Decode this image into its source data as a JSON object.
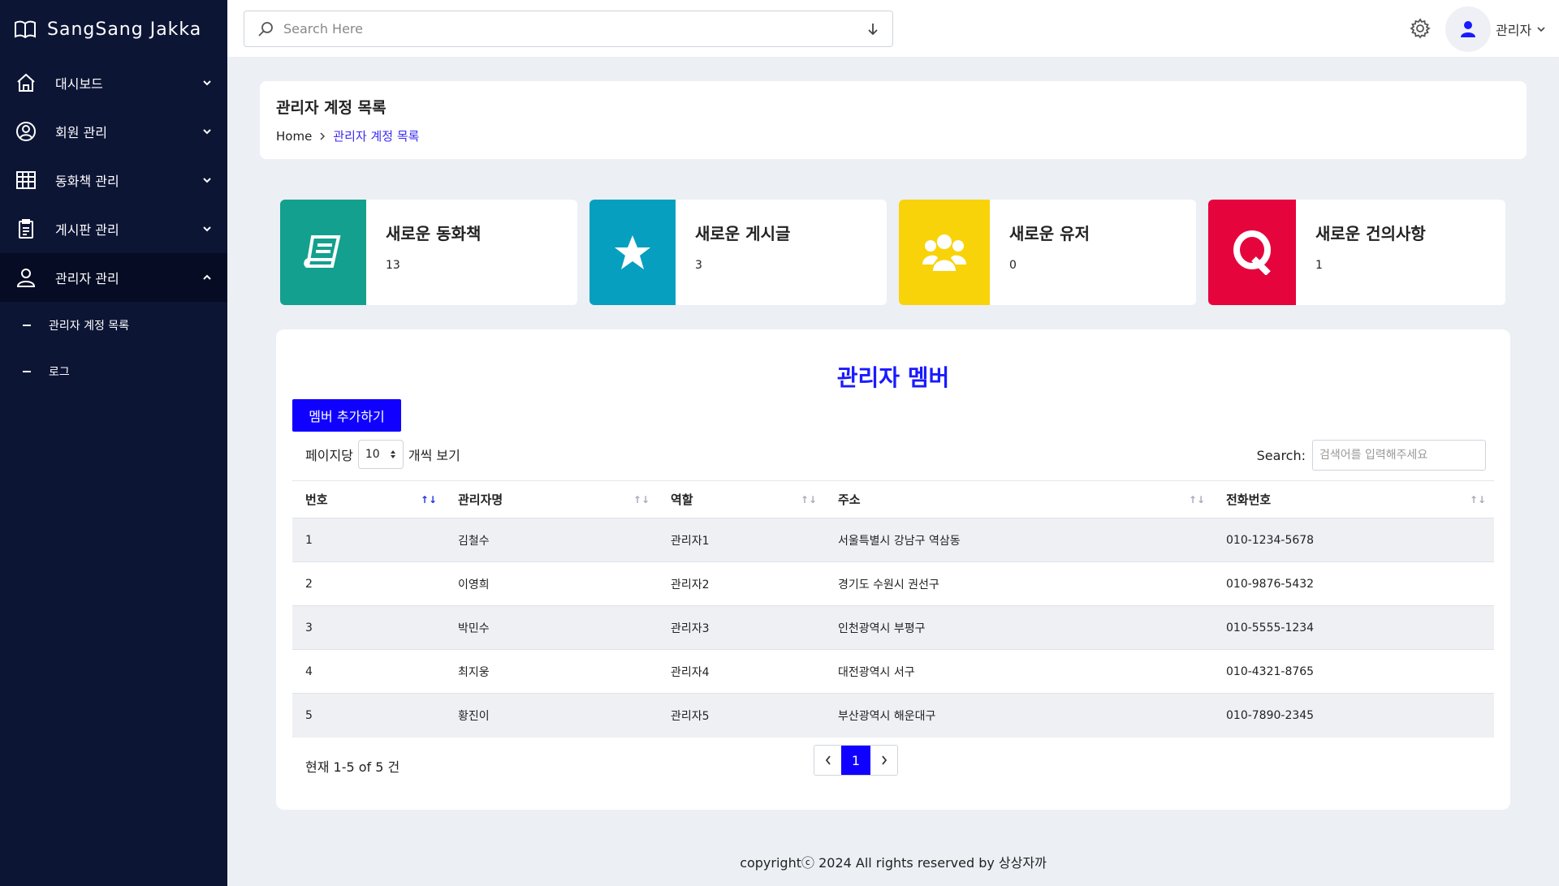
{
  "brand": {
    "name": "SangSang Jakka"
  },
  "sidebar": {
    "items": [
      {
        "label": "대시보드",
        "icon": "home-icon"
      },
      {
        "label": "회원 관리",
        "icon": "user-circle-icon"
      },
      {
        "label": "동화책 관리",
        "icon": "grid-icon"
      },
      {
        "label": "게시판 관리",
        "icon": "clipboard-icon"
      },
      {
        "label": "관리자 관리",
        "icon": "user-icon"
      }
    ],
    "sub_items": [
      {
        "label": "관리자 계정 목록"
      },
      {
        "label": "로그"
      }
    ]
  },
  "topbar": {
    "search_placeholder": "Search Here",
    "user_name": "관리자"
  },
  "header": {
    "title": "관리자 계정 목록",
    "breadcrumb_home": "Home",
    "breadcrumb_current": "관리자 계정 목록"
  },
  "stats": [
    {
      "title": "새로운 동화책",
      "value": "13",
      "color": "#14a08e",
      "icon": "book-icon"
    },
    {
      "title": "새로운 게시글",
      "value": "3",
      "color": "#079fbf",
      "icon": "star-icon"
    },
    {
      "title": "새로운 유저",
      "value": "0",
      "color": "#f8d30a",
      "icon": "users-icon"
    },
    {
      "title": "새로운 건의사항",
      "value": "1",
      "color": "#e6043c",
      "icon": "q-icon"
    }
  ],
  "members": {
    "heading": "관리자 멤버",
    "add_button": "멤버 추가하기",
    "per_page_prefix": "페이지당",
    "per_page_value": "10",
    "per_page_suffix": "개씩 보기",
    "search_label": "Search:",
    "search_placeholder": "검색어를 입력해주세요",
    "columns": [
      "번호",
      "관리자명",
      "역할",
      "주소",
      "전화번호"
    ],
    "rows": [
      [
        "1",
        "김철수",
        "관리자1",
        "서울특별시 강남구 역삼동",
        "010-1234-5678"
      ],
      [
        "2",
        "이영희",
        "관리자2",
        "경기도 수원시 권선구",
        "010-9876-5432"
      ],
      [
        "3",
        "박민수",
        "관리자3",
        "인천광역시 부평구",
        "010-5555-1234"
      ],
      [
        "4",
        "최지웅",
        "관리자4",
        "대전광역시 서구",
        "010-4321-8765"
      ],
      [
        "5",
        "황진이",
        "관리자5",
        "부산광역시 해운대구",
        "010-7890-2345"
      ]
    ],
    "result_info": "현재 1-5 of 5 건",
    "current_page": "1"
  },
  "footer": {
    "text": "copyrightⓒ 2024 All rights reserved by 상상자까"
  },
  "colors": {
    "sidebar": "#0d1535",
    "accent": "#0f00ff"
  }
}
